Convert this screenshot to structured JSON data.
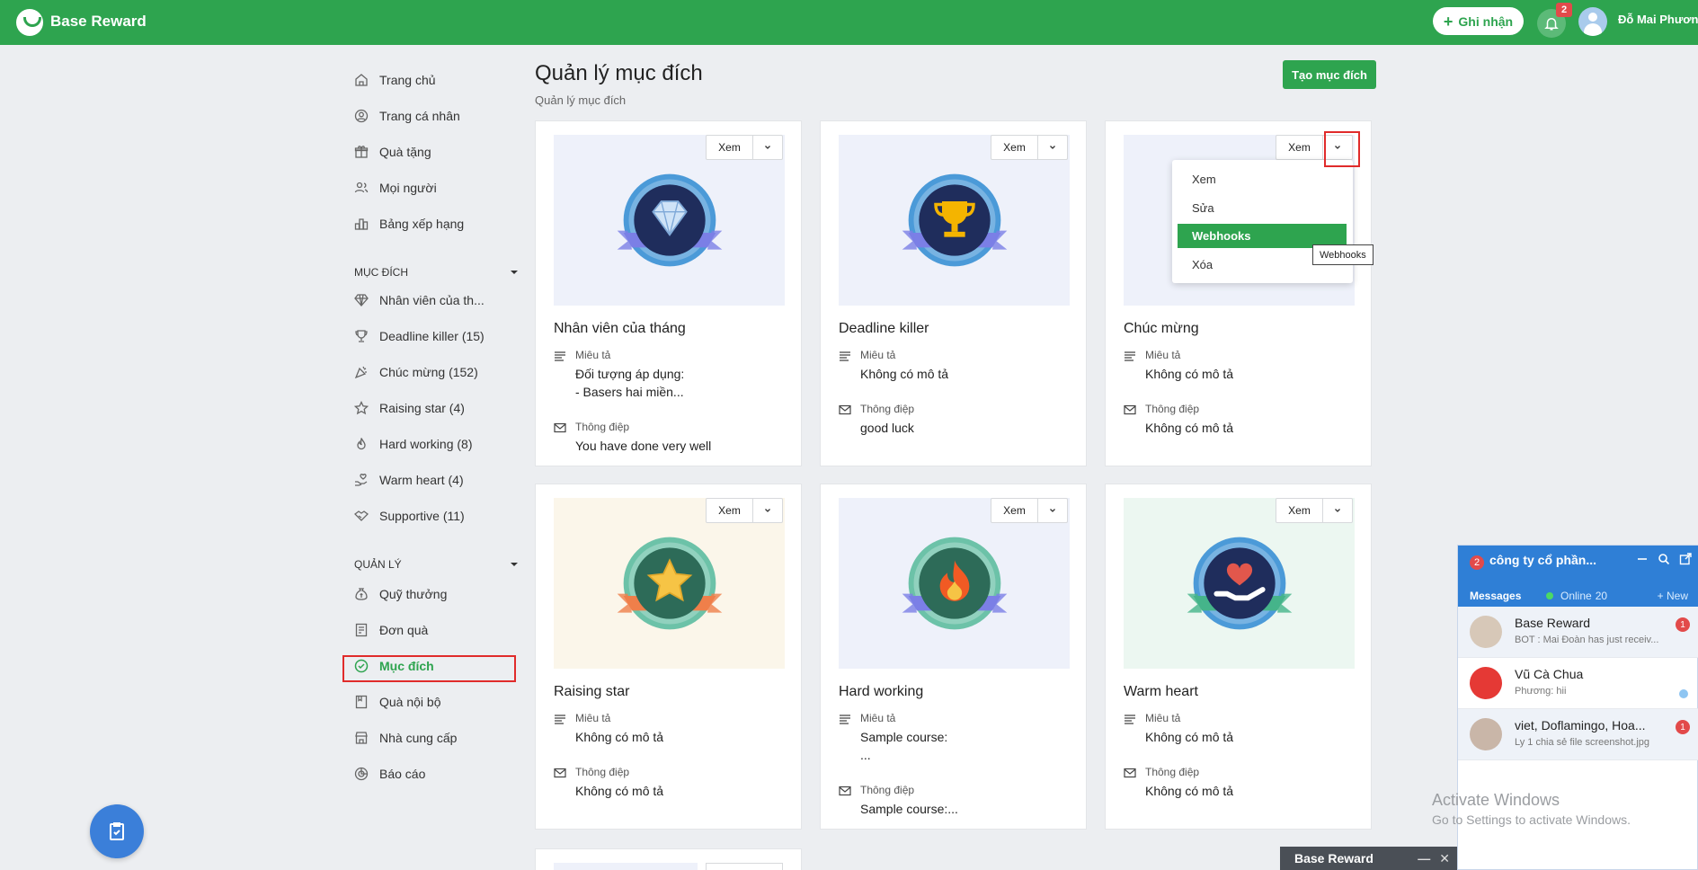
{
  "app": {
    "brand": "Base Reward",
    "ghi_nhan_label": "Ghi nhận",
    "notification_count": "2",
    "user_name": "Đỗ Mai Phương"
  },
  "sidebar": {
    "main_items": [
      {
        "label": "Trang chủ",
        "icon": "home-icon"
      },
      {
        "label": "Trang cá nhân",
        "icon": "profile-icon"
      },
      {
        "label": "Quà tặng",
        "icon": "gift-icon"
      },
      {
        "label": "Mọi người",
        "icon": "people-icon"
      },
      {
        "label": "Bảng xếp hạng",
        "icon": "leaderboard-icon"
      }
    ],
    "section_muc_dich": "MỤC ĐÍCH",
    "muc_dich_items": [
      {
        "label": "Nhân viên của th...",
        "icon": "diamond-icon"
      },
      {
        "label": "Deadline killer (15)",
        "icon": "trophy-icon"
      },
      {
        "label": "Chúc mừng (152)",
        "icon": "party-icon"
      },
      {
        "label": "Raising star (4)",
        "icon": "star-icon"
      },
      {
        "label": "Hard working (8)",
        "icon": "fire-icon"
      },
      {
        "label": "Warm heart (4)",
        "icon": "heart-hand-icon"
      },
      {
        "label": "Supportive (11)",
        "icon": "handshake-icon"
      }
    ],
    "section_quan_ly": "QUẢN LÝ",
    "quan_ly_items": [
      {
        "label": "Quỹ thưởng",
        "icon": "money-bag-icon"
      },
      {
        "label": "Đơn quà",
        "icon": "order-icon"
      },
      {
        "label": "Mục đích",
        "icon": "check-circle-icon"
      },
      {
        "label": "Quà nội bộ",
        "icon": "internal-gift-icon"
      },
      {
        "label": "Nhà cung cấp",
        "icon": "store-icon"
      },
      {
        "label": "Báo cáo",
        "icon": "report-icon"
      }
    ]
  },
  "header": {
    "title": "Quản lý mục đích",
    "subtitle": "Quản lý mục đích",
    "create_button": "Tạo mục đích"
  },
  "card_labels": {
    "view": "Xem",
    "description": "Miêu tả",
    "message": "Thông điệp"
  },
  "cards": [
    {
      "title": "Nhân viên của tháng",
      "description": "Đối tượng áp dụng:\n- Basers hai miền...",
      "message": "You have done very well",
      "badge": "diamond",
      "bg": "#eef1fa"
    },
    {
      "title": "Deadline killer",
      "description": "Không có mô tả",
      "message": "good luck",
      "badge": "trophy",
      "bg": "#eef1fa"
    },
    {
      "title": "Chúc mừng",
      "description": "Không có mô tả",
      "message": "Không có mô tả",
      "badge": "party",
      "bg": "#eef1fa"
    },
    {
      "title": "Raising star",
      "description": "Không có mô tả",
      "message": "Không có mô tả",
      "badge": "star",
      "bg": "#fbf6ea"
    },
    {
      "title": "Hard working",
      "description": "Sample course:\n...",
      "message": "Sample course:...",
      "badge": "fire",
      "bg": "#eef1fa"
    },
    {
      "title": "Warm heart",
      "description": "Không có mô tả",
      "message": "Không có mô tả",
      "badge": "heart",
      "bg": "#ecf7f1"
    }
  ],
  "dropdown": {
    "items": [
      "Xem",
      "Sửa",
      "Webhooks",
      "Xóa"
    ],
    "selected": "Webhooks",
    "tooltip": "Webhooks"
  },
  "chat": {
    "unread": "2",
    "company": "công ty cổ phần...",
    "tab_messages": "Messages",
    "tab_online": "Online",
    "online_count": "20",
    "tab_new": "+ New",
    "conversations": [
      {
        "name": "Base Reward",
        "preview": "BOT : Mai Đoàn has just receiv...",
        "badge": "1"
      },
      {
        "name": "Vũ Cà Chua",
        "preview": "Phương: hii",
        "badge": ""
      },
      {
        "name": "viet, Doflamingo, Hoa...",
        "preview": "Ly 1 chia sẻ file screenshot.jpg",
        "badge": "1"
      }
    ]
  },
  "minibar": {
    "title": "Base Reward"
  },
  "watermark": {
    "line1": "Activate Windows",
    "line2": "Go to Settings to activate Windows."
  },
  "colors": {
    "primary": "#2ea44f",
    "chat_blue": "#2f7fd6",
    "highlight_red": "#e02b2b"
  }
}
